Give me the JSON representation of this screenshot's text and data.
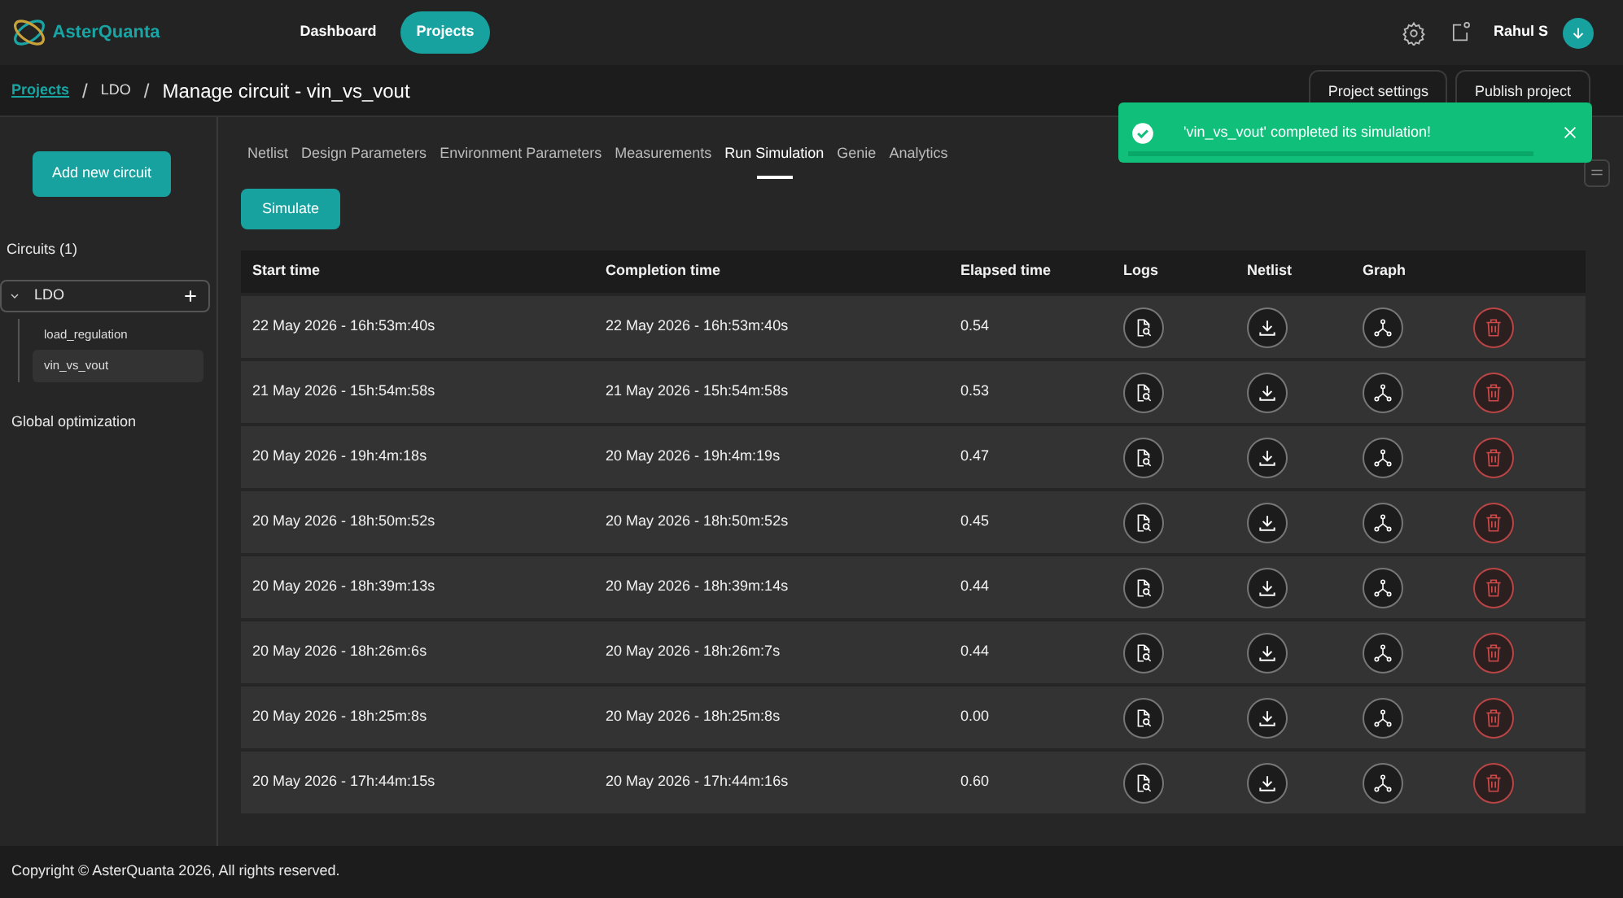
{
  "navbar": {
    "brand": "AsterQuanta",
    "links": [
      {
        "label": "Dashboard",
        "selected": false
      },
      {
        "label": "Projects",
        "selected": true
      }
    ],
    "user": "Rahul S"
  },
  "breadcrumb": {
    "items": [
      "Projects",
      "LDO"
    ],
    "separators": [
      "/",
      "/"
    ],
    "title": "Manage circuit - vin_vs_vout"
  },
  "header_buttons": [
    "Project settings",
    "Publish project"
  ],
  "toast": {
    "message": "'vin_vs_vout' completed its simulation!",
    "level": 0.9
  },
  "sidebar": {
    "add_button": "Add new circuit",
    "circuits_label": "Circuits (1)",
    "circuits": [
      {
        "label": "LDO",
        "expanded": true,
        "children": [
          {
            "label": "load_regulation",
            "selected": false
          },
          {
            "label": "vin_vs_vout",
            "selected": true
          }
        ]
      }
    ],
    "global": "Global optimization"
  },
  "tabs": [
    {
      "label": "Netlist",
      "selected": false
    },
    {
      "label": "Design Parameters",
      "selected": false
    },
    {
      "label": "Environment Parameters",
      "selected": false
    },
    {
      "label": "Measurements",
      "selected": false
    },
    {
      "label": "Run Simulation",
      "selected": true
    },
    {
      "label": "Genie",
      "selected": false
    },
    {
      "label": "Analytics",
      "selected": false
    }
  ],
  "simulate_button": "Simulate",
  "table": {
    "columns": [
      "Start time",
      "Completion time",
      "Elapsed time",
      "Logs",
      "Netlist",
      "Graph"
    ],
    "rows": [
      {
        "start": "22 May 2026 - 16h:53m:40s",
        "end": "22 May 2026 - 16h:53m:40s",
        "elapsed": "0.54"
      },
      {
        "start": "21 May 2026 - 15h:54m:58s",
        "end": "21 May 2026 - 15h:54m:58s",
        "elapsed": "0.53"
      },
      {
        "start": "20 May 2026 - 19h:4m:18s",
        "end": "20 May 2026 - 19h:4m:19s",
        "elapsed": "0.47"
      },
      {
        "start": "20 May 2026 - 18h:50m:52s",
        "end": "20 May 2026 - 18h:50m:52s",
        "elapsed": "0.45"
      },
      {
        "start": "20 May 2026 - 18h:39m:13s",
        "end": "20 May 2026 - 18h:39m:14s",
        "elapsed": "0.44"
      },
      {
        "start": "20 May 2026 - 18h:26m:6s",
        "end": "20 May 2026 - 18h:26m:7s",
        "elapsed": "0.44"
      },
      {
        "start": "20 May 2026 - 18h:25m:8s",
        "end": "20 May 2026 - 18h:25m:8s",
        "elapsed": "0.00"
      },
      {
        "start": "20 May 2026 - 17h:44m:15s",
        "end": "20 May 2026 - 17h:44m:16s",
        "elapsed": "0.60"
      }
    ]
  },
  "footer": "Copyright © AsterQuanta 2026, All rights reserved."
}
